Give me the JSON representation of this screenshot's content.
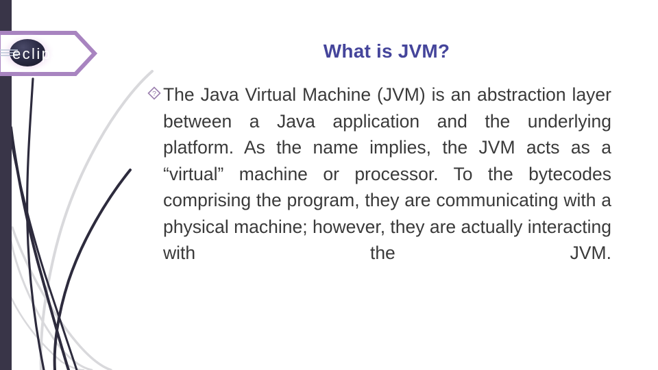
{
  "slide": {
    "title": "What is JVM?",
    "title_color": "#45459b",
    "body_text_color": "#3a3a3a",
    "background_color": "#ffffff"
  },
  "logo": {
    "wordmark": "eclipse",
    "border_color": "#a884c0",
    "orb_color": "#2b2b45",
    "glow_color": "#e7c8e8",
    "text_color": "#ffffff"
  },
  "decor": {
    "bar_color": "#393548",
    "dark_stroke_color": "#2d2b3d",
    "light_stroke_color": "#d8d8da"
  },
  "bullet": {
    "icon": "diamond-question-icon",
    "icon_color": "#9b7fae",
    "text": "The Java Virtual Machine (JVM) is an abstraction layer between a Java application and the underlying platform. As the name implies, the JVM acts as a “virtual” machine or processor. To the bytecodes comprising the program, they are communicating with a physical machine; however, they are actually interacting with the JVM."
  }
}
